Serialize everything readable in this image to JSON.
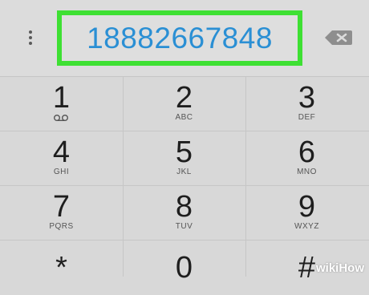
{
  "display": {
    "number": "18882667848"
  },
  "colors": {
    "highlight": "#3ee033",
    "number": "#2a8fd4"
  },
  "icons": {
    "menu": "more-vert-icon",
    "backspace": "backspace-icon",
    "voicemail": "voicemail-icon"
  },
  "keypad": [
    {
      "digit": "1",
      "letters": ""
    },
    {
      "digit": "2",
      "letters": "ABC"
    },
    {
      "digit": "3",
      "letters": "DEF"
    },
    {
      "digit": "4",
      "letters": "GHI"
    },
    {
      "digit": "5",
      "letters": "JKL"
    },
    {
      "digit": "6",
      "letters": "MNO"
    },
    {
      "digit": "7",
      "letters": "PQRS"
    },
    {
      "digit": "8",
      "letters": "TUV"
    },
    {
      "digit": "9",
      "letters": "WXYZ"
    },
    {
      "digit": "*",
      "letters": ""
    },
    {
      "digit": "0",
      "letters": ""
    },
    {
      "digit": "#",
      "letters": ""
    }
  ],
  "watermark": {
    "text": "wikiHow"
  }
}
